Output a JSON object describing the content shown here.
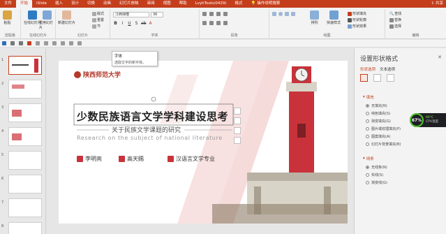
{
  "tabs": [
    "文件",
    "开始",
    "iSlide",
    "插入",
    "设计",
    "切换",
    "动画",
    "幻灯片放映",
    "审阅",
    "视图",
    "帮助",
    "LvyhTools(0429)",
    "格式"
  ],
  "active_tab_index": 1,
  "search_label": "操作说明搜索",
  "share_label": "共享",
  "ribbon": {
    "paste_label": "粘贴",
    "new_online_label": "在线幻灯片",
    "new_slide_label": "新建幻灯片",
    "reuse_label": "重用幻灯片",
    "layout_label": "版式",
    "reset_label": "重置",
    "section_label": "节",
    "font_name": "江西拙楷",
    "font_size": "36",
    "draw_label": "绘图",
    "arrange_label": "排列",
    "quick_style_label": "快速样式",
    "shape_fill_label": "形状填充",
    "shape_outline_label": "形状轮廓",
    "shape_effect_label": "形状效果",
    "find_label": "查找",
    "replace_label": "替换",
    "select_label": "选择",
    "groups": {
      "clipboard": "剪贴板",
      "online": "在线幻灯片",
      "slides": "幻灯片",
      "font": "字体",
      "paragraph": "段落",
      "drawing": "绘图",
      "editing": "编辑"
    }
  },
  "tooltip": {
    "title": "字体",
    "desc": "选取文字的新字体。"
  },
  "thumbnails": [
    {
      "num": "1",
      "selected": true
    },
    {
      "num": "2"
    },
    {
      "num": "3"
    },
    {
      "num": "4"
    },
    {
      "num": "5"
    },
    {
      "num": "6"
    },
    {
      "num": "7"
    },
    {
      "num": "8"
    }
  ],
  "slide": {
    "logo_text": "陕西师范大学",
    "title": "少数民族语言文学学科建设思考",
    "subtitle": "关于民族文学课题的研究",
    "english": "Research on the subject of national literature",
    "person1": "李明亮",
    "person2": "高天赐",
    "major": "汉语言文学专业"
  },
  "format_pane": {
    "title": "设置形状格式",
    "tab_shape": "形状选项",
    "tab_text": "文本选项",
    "fill_section": "填充",
    "fill_options": [
      "无填充(N)",
      "纯色填充(S)",
      "渐变填充(G)",
      "图片或纹理填充(P)",
      "图案填充(A)",
      "幻灯片背景填充(B)"
    ],
    "fill_selected_index": 0,
    "line_section": "线条",
    "line_options": [
      "无线条(N)",
      "实线(S)",
      "渐变线(G)"
    ],
    "line_selected_index": 0
  },
  "cpu": {
    "percent": "67%",
    "temp": "60°C",
    "label": "CPU温度"
  },
  "colors": {
    "accent": "#c43e1c",
    "brand_red": "#c9323a"
  }
}
